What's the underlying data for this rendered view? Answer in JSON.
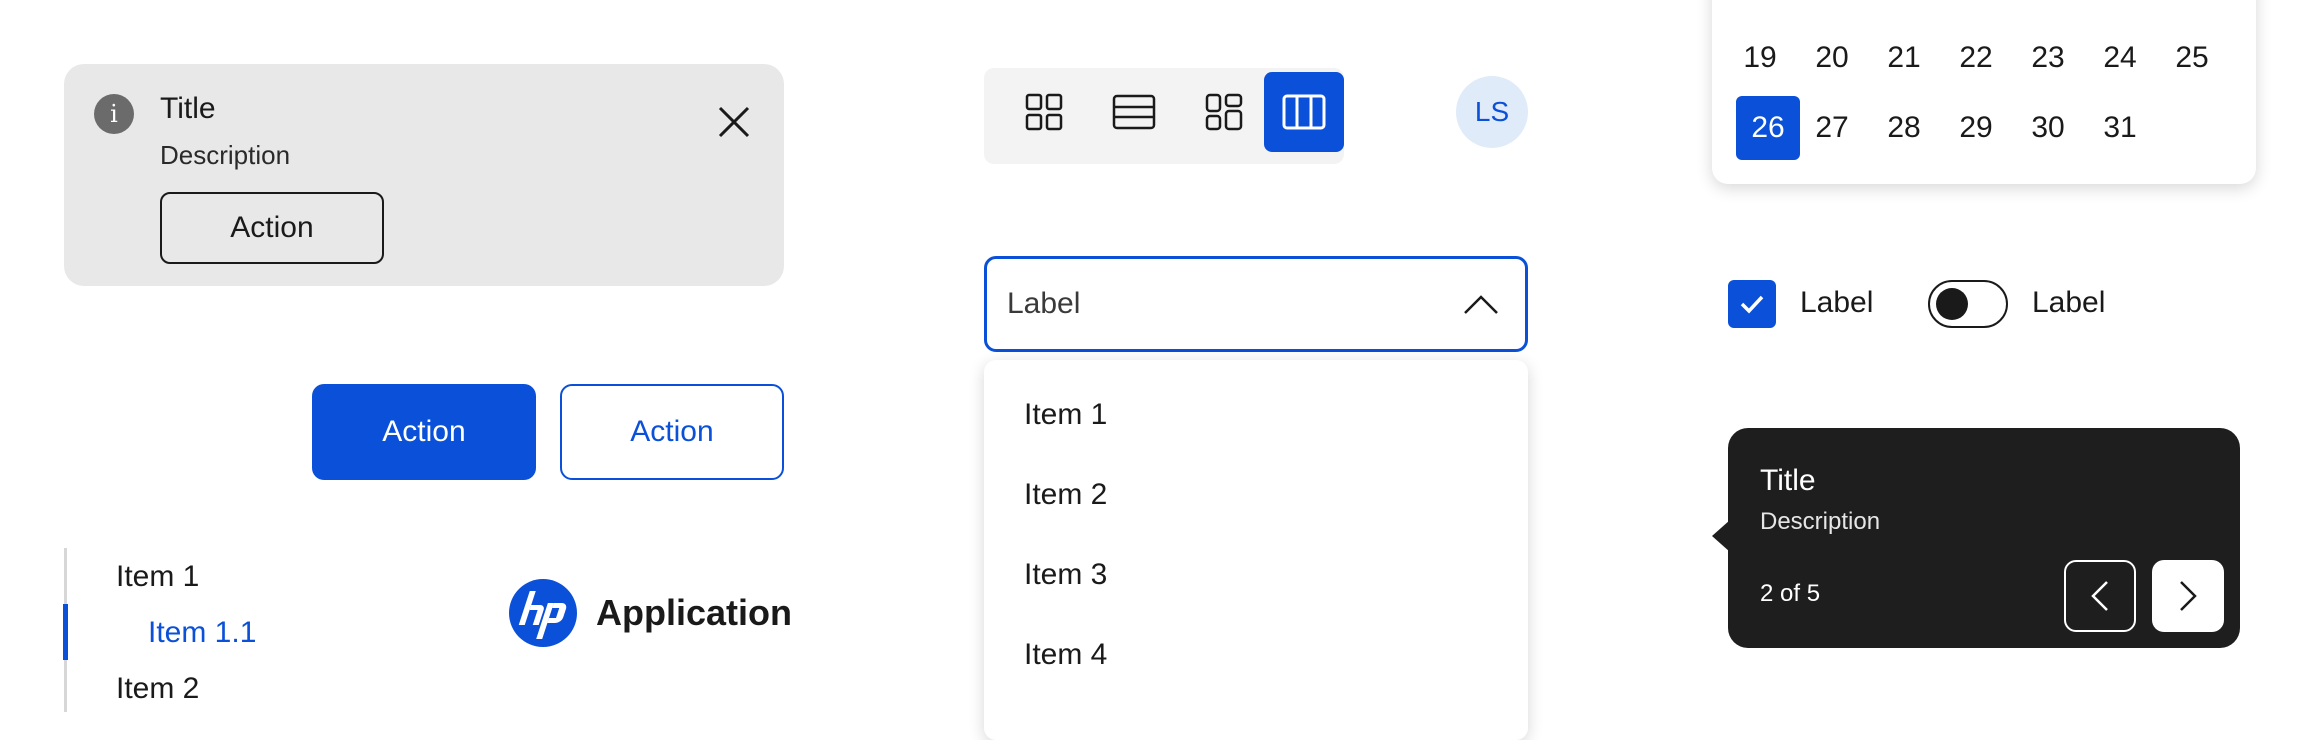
{
  "notification": {
    "title": "Title",
    "description": "Description",
    "action_label": "Action",
    "icon": "info-icon",
    "close_icon": "close-icon"
  },
  "buttons": {
    "primary_label": "Action",
    "secondary_label": "Action"
  },
  "side_nav": {
    "items": [
      {
        "label": "Item 1",
        "level": 1
      },
      {
        "label": "Item 1.1",
        "level": 2,
        "active": true
      },
      {
        "label": "Item 2",
        "level": 1
      }
    ]
  },
  "brand": {
    "logo": "hp-logo",
    "app_name": "Application"
  },
  "view_switcher": {
    "options": [
      {
        "icon": "grid-view-icon"
      },
      {
        "icon": "list-view-icon"
      },
      {
        "icon": "tile-view-icon"
      },
      {
        "icon": "column-view-icon",
        "active": true
      }
    ]
  },
  "avatar": {
    "initials": "LS"
  },
  "select": {
    "label": "Label",
    "icon": "chevron-up-icon",
    "options": [
      "Item 1",
      "Item 2",
      "Item 3",
      "Item 4"
    ]
  },
  "calendar": {
    "rows": [
      [
        "19",
        "20",
        "21",
        "22",
        "23",
        "24",
        "25"
      ],
      [
        "26",
        "27",
        "28",
        "29",
        "30",
        "31"
      ]
    ],
    "selected": "26"
  },
  "checkbox": {
    "label": "Label",
    "checked": true
  },
  "toggle": {
    "label": "Label",
    "on": false
  },
  "tooltip": {
    "title": "Title",
    "description": "Description",
    "counter": "2 of 5",
    "prev_icon": "chevron-left-icon",
    "next_icon": "chevron-right-icon"
  },
  "colors": {
    "accent": "#0a50d8",
    "notification_bg": "#e8e8e8",
    "tooltip_bg": "#1e1e1e",
    "avatar_bg": "#e0ebf9"
  }
}
